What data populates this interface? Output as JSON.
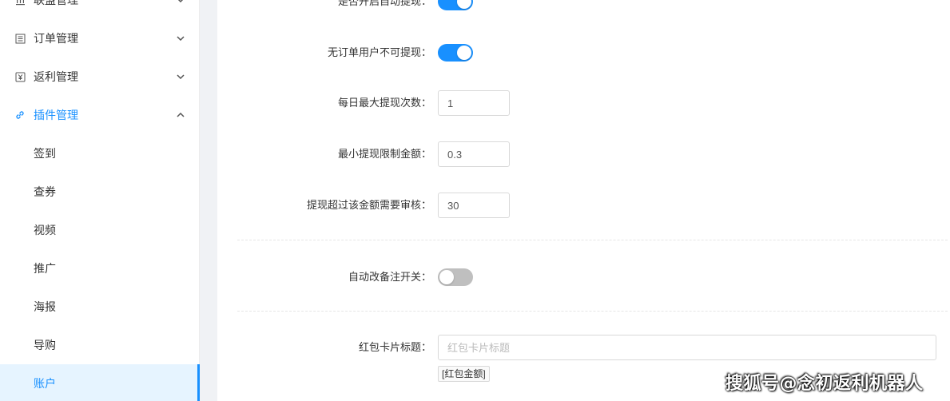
{
  "sidebar": {
    "menus": [
      {
        "label": "联盟管理",
        "icon": "bank-icon",
        "expanded": false
      },
      {
        "label": "订单管理",
        "icon": "list-icon",
        "expanded": false
      },
      {
        "label": "返利管理",
        "icon": "rebate-icon",
        "expanded": false
      },
      {
        "label": "插件管理",
        "icon": "link-icon",
        "expanded": true
      }
    ],
    "subitems": [
      {
        "label": "签到"
      },
      {
        "label": "查券"
      },
      {
        "label": "视频"
      },
      {
        "label": "推广"
      },
      {
        "label": "海报"
      },
      {
        "label": "导购"
      },
      {
        "label": "账户",
        "selected": true
      }
    ]
  },
  "form": {
    "auto_withdraw": {
      "label": "是否开启自动提现：",
      "on": true
    },
    "no_order_withdraw": {
      "label": "无订单用户不可提现：",
      "on": true
    },
    "max_daily": {
      "label": "每日最大提现次数：",
      "value": "1"
    },
    "min_amount": {
      "label": "最小提现限制金额：",
      "value": "0.3"
    },
    "review_threshold": {
      "label": "提现超过该金额需要审核：",
      "value": "30"
    },
    "auto_remark": {
      "label": "自动改备注开关：",
      "on": false
    },
    "card_title": {
      "label": "红包卡片标题：",
      "placeholder": "红包卡片标题",
      "value": ""
    },
    "tag_amount": "[红包金额]"
  },
  "watermark": "搜狐号@念初返利机器人",
  "colors": {
    "primary": "#1890ff",
    "switch_off": "#bfbfbf",
    "gutter": "#f0f2f5"
  }
}
